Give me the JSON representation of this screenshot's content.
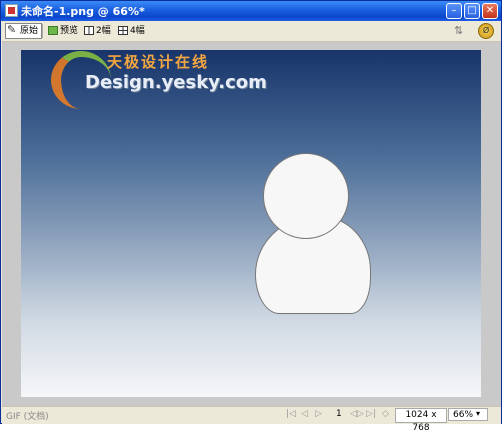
{
  "window": {
    "title": "未命名-1.png @ 66%*",
    "minimize_glyph": "–",
    "maximize_glyph": "□",
    "close_glyph": "✕"
  },
  "toolbar": {
    "tabs": [
      {
        "label": "原始",
        "icon": "pencil-icon"
      },
      {
        "label": "预览",
        "icon": "preview-icon"
      },
      {
        "label": "2幅",
        "icon": "two-up-icon"
      },
      {
        "label": "4幅",
        "icon": "four-up-icon"
      }
    ],
    "right_icons": [
      "quick-export-icon",
      "export-preview-icon"
    ]
  },
  "watermark": {
    "chinese": "天极设计在线",
    "english": "Design.yesky.com"
  },
  "statusbar": {
    "doc_type": "GIF (文档)",
    "page": "1",
    "dimensions": "1024 x 768",
    "zoom": "66%",
    "zoom_arrow": "▾",
    "nav_first": "|◁",
    "nav_prev": "◁",
    "nav_next": "▷",
    "nav_last": "▷|",
    "nav_loop": "◁▷",
    "nav_extra": "◇"
  }
}
